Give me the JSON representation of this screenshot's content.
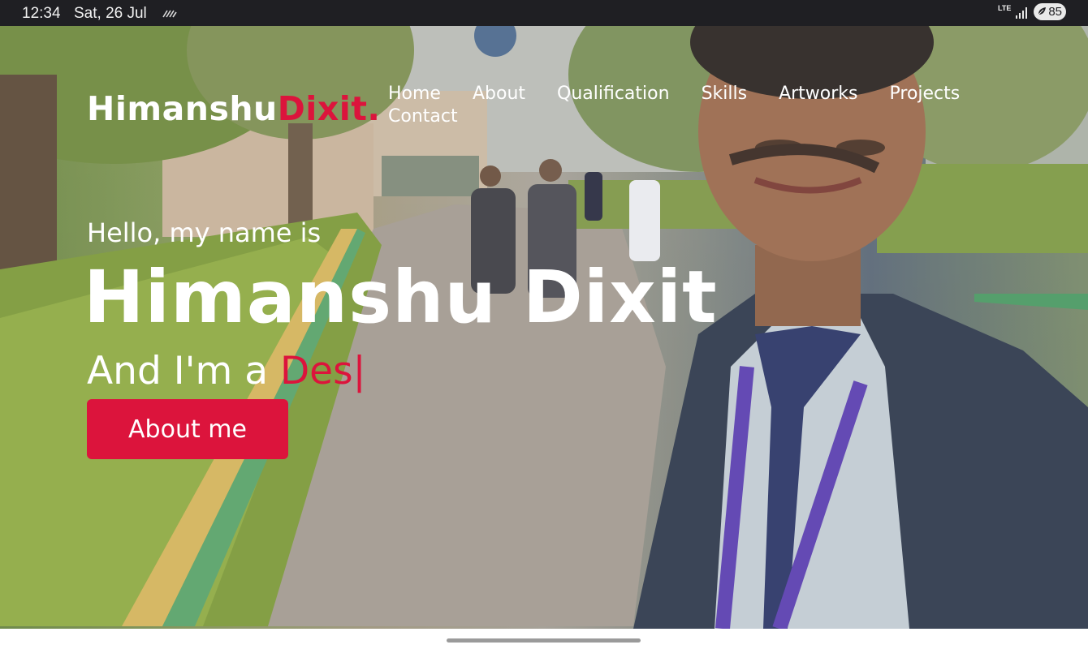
{
  "status_bar": {
    "time": "12:34",
    "date": "Sat, 26 Jul",
    "network": "LTE",
    "battery": "85",
    "icons": [
      "notification-icon",
      "lte-icon",
      "signal-icon",
      "battery-saver-icon"
    ]
  },
  "site": {
    "logo_first": "Himanshu",
    "logo_second": "Dixit",
    "logo_dot": ".",
    "accent_color": "#dc143c",
    "nav": [
      "Home",
      "About",
      "Qualification",
      "Skills",
      "Artworks",
      "Projects",
      "Contact"
    ]
  },
  "hero": {
    "greeting": "Hello, my name is",
    "name": "Himanshu Dixit",
    "role_prefix": "And I'm a ",
    "role_typed": "Des",
    "cursor": "|",
    "button": "About me"
  }
}
